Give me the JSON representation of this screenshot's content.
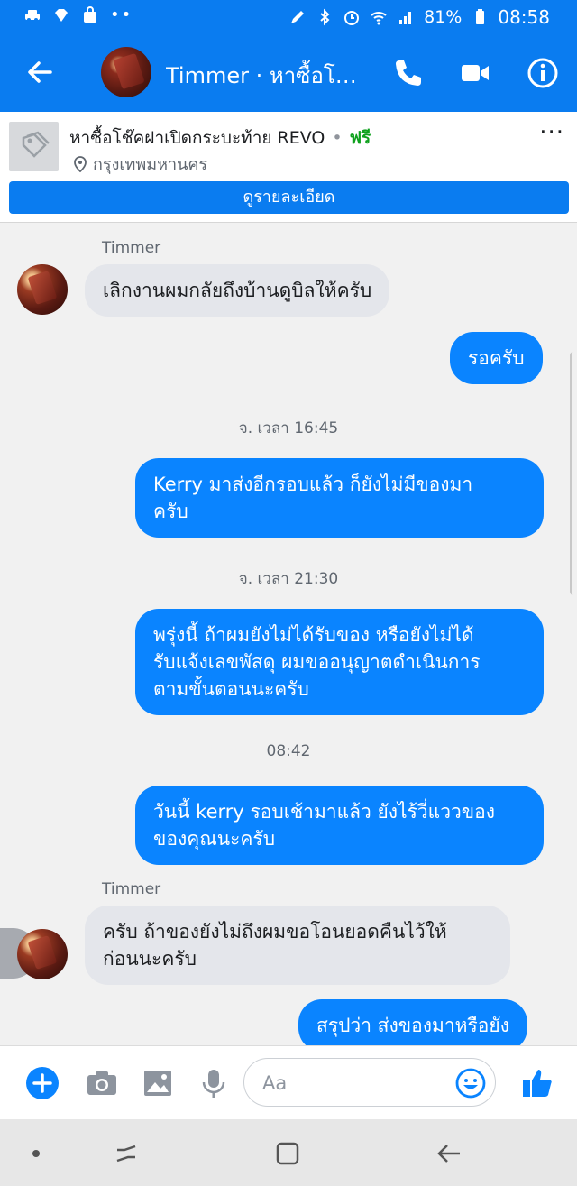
{
  "status_bar": {
    "battery": "81%",
    "time": "08:58",
    "icons": [
      "car-icon",
      "diamond-icon",
      "shopping-bag-icon",
      "more-dots-icon",
      "pen-icon",
      "bluetooth-icon",
      "alarm-icon",
      "wifi-icon",
      "signal-icon",
      "battery-icon"
    ]
  },
  "header": {
    "title": "Timmer · หาซื้อโช๊...",
    "icons": [
      "back-arrow-icon",
      "phone-icon",
      "video-icon",
      "info-icon"
    ]
  },
  "listing": {
    "title": "หาซื้อโช๊คฝาเปิดกระบะท้าย REVO",
    "separator": "•",
    "price": "ฟรี",
    "location": "กรุงเทพมหานคร",
    "more_label": "···",
    "details_button": "ดูรายละเอียด"
  },
  "chat": {
    "messages": [
      {
        "type": "sender",
        "text": "Timmer"
      },
      {
        "type": "in",
        "text": "เลิกงานผมกลัยถึงบ้านดูบิลให้ครับ"
      },
      {
        "type": "out",
        "text": "รอครับ"
      },
      {
        "type": "timestamp",
        "text": "จ. เวลา 16:45"
      },
      {
        "type": "out",
        "lines": [
          "Kerry มาส่งอีกรอบแล้ว ก็ยังไม่มีของมา",
          "ครับ"
        ]
      },
      {
        "type": "timestamp",
        "text": "จ. เวลา 21:30"
      },
      {
        "type": "out",
        "lines": [
          "พรุ่งนี้ ถ้าผมยังไม่ได้รับของ หรือยังไม่ได้",
          "รับแจ้งเลขพัสดุ ผมขออนุญาตดำเนินการ",
          "ตามขั้นตอนนะครับ"
        ]
      },
      {
        "type": "timestamp",
        "text": "08:42"
      },
      {
        "type": "out",
        "lines": [
          "วันนี้ kerry รอบเช้ามาแล้ว ยังไร้วี่แววของ",
          "ของคุณนะครับ"
        ]
      },
      {
        "type": "sender",
        "text": "Timmer"
      },
      {
        "type": "in",
        "lines": [
          "ครับ ถ้าของยังไม่ถึงผมขอโอนยอดคืนไว้ให้",
          "ก่อนนะครับ"
        ]
      },
      {
        "type": "out",
        "text": "สรุปว่า ส่งของมาหรือยัง"
      }
    ]
  },
  "composer": {
    "placeholder": "Aa",
    "icons": [
      "plus-icon",
      "camera-icon",
      "gallery-icon",
      "microphone-icon",
      "emoji-icon",
      "thumbs-up-icon"
    ],
    "accent": "#0a84ff"
  },
  "nav_bar": {
    "icons": [
      "home-dot-icon",
      "recent-apps-icon",
      "home-icon",
      "back-icon"
    ]
  },
  "colors": {
    "brand_blue": "#0a7cf0",
    "price_green": "#0ea11d",
    "incoming_bubble": "#e4e6eb"
  }
}
